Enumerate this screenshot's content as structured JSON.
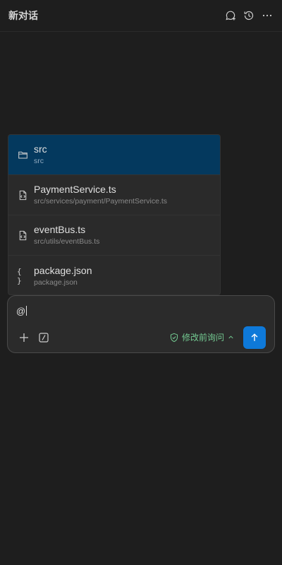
{
  "header": {
    "title": "新对话",
    "icons": [
      "new-chat-icon",
      "history-icon",
      "more-icon"
    ]
  },
  "suggestions": [
    {
      "name": "src",
      "path": "src",
      "icon": "folder-icon",
      "active": true
    },
    {
      "name": "PaymentService.ts",
      "path": "src/services/payment/PaymentService.ts",
      "icon": "file-code-icon",
      "active": false
    },
    {
      "name": "eventBus.ts",
      "path": "src/utils/eventBus.ts",
      "icon": "file-code-icon",
      "active": false
    },
    {
      "name": "package.json",
      "path": "package.json",
      "icon": "json-braces-icon",
      "active": false
    }
  ],
  "composer": {
    "input_value": "@",
    "mode_label": "修改前询问",
    "colors": {
      "send": "#0e79d9",
      "mode": "#73c991",
      "active_item": "#04395e"
    }
  }
}
